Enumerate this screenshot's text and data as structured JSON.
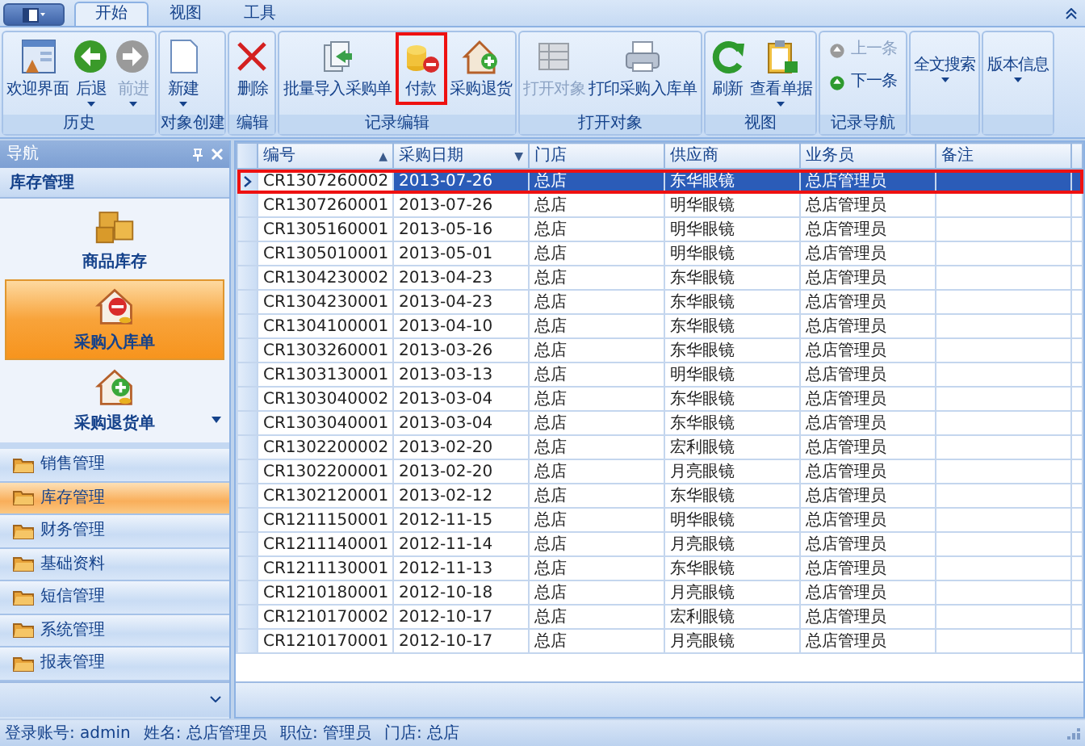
{
  "tabs": [
    {
      "label": "开始",
      "selected": true
    },
    {
      "label": "视图",
      "selected": false
    },
    {
      "label": "工具",
      "selected": false
    }
  ],
  "ribbon_groups": [
    {
      "label": "历史",
      "buttons": [
        {
          "label": "欢迎界面",
          "kind": "large",
          "disabled": false,
          "dropdown": false,
          "highlighted": false
        },
        {
          "label": "后退",
          "kind": "large",
          "disabled": false,
          "dropdown": true,
          "highlighted": false
        },
        {
          "label": "前进",
          "kind": "large",
          "disabled": true,
          "dropdown": true,
          "highlighted": false
        }
      ]
    },
    {
      "label": "对象创建",
      "buttons": [
        {
          "label": "新建",
          "kind": "large",
          "disabled": false,
          "dropdown": true,
          "highlighted": false
        }
      ]
    },
    {
      "label": "编辑",
      "buttons": [
        {
          "label": "删除",
          "kind": "large",
          "disabled": false,
          "dropdown": false,
          "highlighted": false
        }
      ]
    },
    {
      "label": "记录编辑",
      "buttons": [
        {
          "label": "批量导入采购单",
          "kind": "large",
          "disabled": false,
          "dropdown": false,
          "highlighted": false
        },
        {
          "label": "付款",
          "kind": "large",
          "disabled": false,
          "dropdown": false,
          "highlighted": true
        },
        {
          "label": "采购退货",
          "kind": "large",
          "disabled": false,
          "dropdown": false,
          "highlighted": false
        }
      ]
    },
    {
      "label": "打开对象",
      "buttons": [
        {
          "label": "打开对象",
          "kind": "large",
          "disabled": true,
          "dropdown": false,
          "highlighted": false
        },
        {
          "label": "打印采购入库单",
          "kind": "large",
          "disabled": false,
          "dropdown": false,
          "highlighted": false
        }
      ]
    },
    {
      "label": "视图",
      "buttons": [
        {
          "label": "刷新",
          "kind": "large",
          "disabled": false,
          "dropdown": false,
          "highlighted": false
        },
        {
          "label": "查看单据",
          "kind": "large",
          "disabled": false,
          "dropdown": true,
          "highlighted": false
        }
      ]
    },
    {
      "label": "记录导航",
      "buttons": [
        {
          "label": "上一条",
          "kind": "small",
          "disabled": true,
          "dropdown": false,
          "highlighted": false
        },
        {
          "label": "下一条",
          "kind": "small",
          "disabled": false,
          "dropdown": false,
          "highlighted": false
        }
      ]
    },
    {
      "buttons": [
        {
          "label": "全文搜索",
          "kind": "text",
          "disabled": false,
          "dropdown": true,
          "highlighted": false
        }
      ]
    },
    {
      "buttons": [
        {
          "label": "版本信息",
          "kind": "text",
          "disabled": false,
          "dropdown": true,
          "highlighted": false
        }
      ]
    }
  ],
  "navigation": {
    "title": "导航",
    "section": "库存管理",
    "items": [
      {
        "label": "商品库存",
        "selected": false
      },
      {
        "label": "采购入库单",
        "selected": true
      },
      {
        "label": "采购退货单",
        "selected": false
      }
    ],
    "categories": [
      {
        "label": "销售管理",
        "selected": false
      },
      {
        "label": "库存管理",
        "selected": true
      },
      {
        "label": "财务管理",
        "selected": false
      },
      {
        "label": "基础资料",
        "selected": false
      },
      {
        "label": "短信管理",
        "selected": false
      },
      {
        "label": "系统管理",
        "selected": false
      },
      {
        "label": "报表管理",
        "selected": false
      }
    ]
  },
  "table": {
    "columns": [
      {
        "label": "编号",
        "sort_indicator": "▲"
      },
      {
        "label": "采购日期",
        "sort_indicator": "▼"
      },
      {
        "label": "门店"
      },
      {
        "label": "供应商"
      },
      {
        "label": "业务员"
      },
      {
        "label": "备注"
      }
    ],
    "rows": [
      {
        "cells": [
          "CR1307260002",
          "2013-07-26",
          "总店",
          "东华眼镜",
          "总店管理员"
        ],
        "selected": true,
        "current": true,
        "highlighted": true
      },
      {
        "cells": [
          "CR1307260001",
          "2013-07-26",
          "总店",
          "明华眼镜",
          "总店管理员"
        ],
        "selected": false,
        "current": false,
        "highlighted": false
      },
      {
        "cells": [
          "CR1305160001",
          "2013-05-16",
          "总店",
          "明华眼镜",
          "总店管理员"
        ],
        "selected": false,
        "current": false,
        "highlighted": false
      },
      {
        "cells": [
          "CR1305010001",
          "2013-05-01",
          "总店",
          "明华眼镜",
          "总店管理员"
        ],
        "selected": false,
        "current": false,
        "highlighted": false
      },
      {
        "cells": [
          "CR1304230002",
          "2013-04-23",
          "总店",
          "东华眼镜",
          "总店管理员"
        ],
        "selected": false,
        "current": false,
        "highlighted": false
      },
      {
        "cells": [
          "CR1304230001",
          "2013-04-23",
          "总店",
          "东华眼镜",
          "总店管理员"
        ],
        "selected": false,
        "current": false,
        "highlighted": false
      },
      {
        "cells": [
          "CR1304100001",
          "2013-04-10",
          "总店",
          "东华眼镜",
          "总店管理员"
        ],
        "selected": false,
        "current": false,
        "highlighted": false
      },
      {
        "cells": [
          "CR1303260001",
          "2013-03-26",
          "总店",
          "东华眼镜",
          "总店管理员"
        ],
        "selected": false,
        "current": false,
        "highlighted": false
      },
      {
        "cells": [
          "CR1303130001",
          "2013-03-13",
          "总店",
          "明华眼镜",
          "总店管理员"
        ],
        "selected": false,
        "current": false,
        "highlighted": false
      },
      {
        "cells": [
          "CR1303040002",
          "2013-03-04",
          "总店",
          "东华眼镜",
          "总店管理员"
        ],
        "selected": false,
        "current": false,
        "highlighted": false
      },
      {
        "cells": [
          "CR1303040001",
          "2013-03-04",
          "总店",
          "东华眼镜",
          "总店管理员"
        ],
        "selected": false,
        "current": false,
        "highlighted": false
      },
      {
        "cells": [
          "CR1302200002",
          "2013-02-20",
          "总店",
          "宏利眼镜",
          "总店管理员"
        ],
        "selected": false,
        "current": false,
        "highlighted": false
      },
      {
        "cells": [
          "CR1302200001",
          "2013-02-20",
          "总店",
          "月亮眼镜",
          "总店管理员"
        ],
        "selected": false,
        "current": false,
        "highlighted": false
      },
      {
        "cells": [
          "CR1302120001",
          "2013-02-12",
          "总店",
          "东华眼镜",
          "总店管理员"
        ],
        "selected": false,
        "current": false,
        "highlighted": false
      },
      {
        "cells": [
          "CR1211150001",
          "2012-11-15",
          "总店",
          "明华眼镜",
          "总店管理员"
        ],
        "selected": false,
        "current": false,
        "highlighted": false
      },
      {
        "cells": [
          "CR1211140001",
          "2012-11-14",
          "总店",
          "月亮眼镜",
          "总店管理员"
        ],
        "selected": false,
        "current": false,
        "highlighted": false
      },
      {
        "cells": [
          "CR1211130001",
          "2012-11-13",
          "总店",
          "东华眼镜",
          "总店管理员"
        ],
        "selected": false,
        "current": false,
        "highlighted": false
      },
      {
        "cells": [
          "CR1210180001",
          "2012-10-18",
          "总店",
          "月亮眼镜",
          "总店管理员"
        ],
        "selected": false,
        "current": false,
        "highlighted": false
      },
      {
        "cells": [
          "CR1210170002",
          "2012-10-17",
          "总店",
          "宏利眼镜",
          "总店管理员"
        ],
        "selected": false,
        "current": false,
        "highlighted": false
      },
      {
        "cells": [
          "CR1210170001",
          "2012-10-17",
          "总店",
          "月亮眼镜",
          "总店管理员"
        ],
        "selected": false,
        "current": false,
        "highlighted": false
      }
    ]
  },
  "status_bar": [
    "登录账号: admin",
    "姓名: 总店管理员",
    "职位: 管理员",
    "门店: 总店"
  ]
}
